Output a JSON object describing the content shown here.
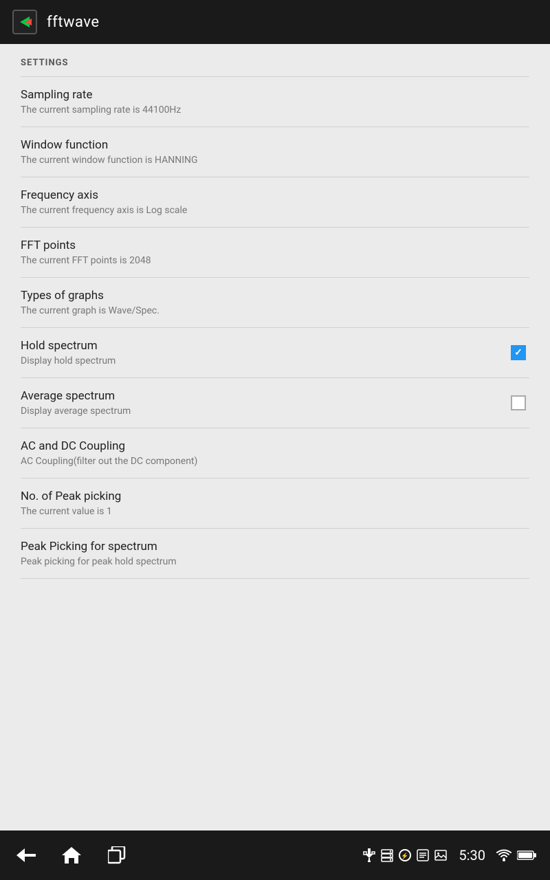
{
  "appBar": {
    "title": "fftwave",
    "logoAlt": "fftwave logo"
  },
  "settingsHeader": "SETTINGS",
  "settingsItems": [
    {
      "id": "sampling-rate",
      "title": "Sampling rate",
      "subtitle": "The current sampling rate is 44100Hz",
      "hasCheckbox": false,
      "checked": null
    },
    {
      "id": "window-function",
      "title": "Window function",
      "subtitle": "The current window function is HANNING",
      "hasCheckbox": false,
      "checked": null
    },
    {
      "id": "frequency-axis",
      "title": "Frequency axis",
      "subtitle": "The current frequency axis is Log scale",
      "hasCheckbox": false,
      "checked": null
    },
    {
      "id": "fft-points",
      "title": "FFT points",
      "subtitle": "The current FFT points is 2048",
      "hasCheckbox": false,
      "checked": null
    },
    {
      "id": "types-of-graphs",
      "title": "Types of graphs",
      "subtitle": "The current graph is Wave/Spec.",
      "hasCheckbox": false,
      "checked": null
    },
    {
      "id": "hold-spectrum",
      "title": "Hold spectrum",
      "subtitle": "Display hold spectrum",
      "hasCheckbox": true,
      "checked": true
    },
    {
      "id": "average-spectrum",
      "title": "Average spectrum",
      "subtitle": "Display average spectrum",
      "hasCheckbox": true,
      "checked": false
    },
    {
      "id": "ac-dc-coupling",
      "title": "AC and DC Coupling",
      "subtitle": "AC Coupling(filter out the DC component)",
      "hasCheckbox": false,
      "checked": null
    },
    {
      "id": "no-peak-picking",
      "title": "No. of Peak picking",
      "subtitle": "The current value is 1",
      "hasCheckbox": false,
      "checked": null
    },
    {
      "id": "peak-picking-spectrum",
      "title": "Peak Picking for spectrum",
      "subtitle": "Peak picking for peak hold spectrum",
      "hasCheckbox": false,
      "checked": null
    }
  ],
  "navBar": {
    "backLabel": "Back",
    "homeLabel": "Home",
    "recentLabel": "Recent Apps",
    "time": "5:30",
    "statusIcons": [
      "usb",
      "storage",
      "usb2",
      "news",
      "image",
      "wifi",
      "battery"
    ]
  }
}
